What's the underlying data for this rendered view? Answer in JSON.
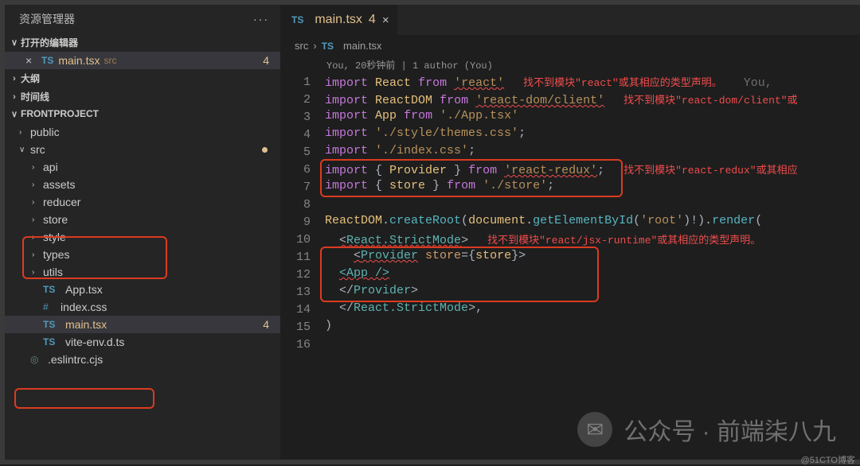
{
  "sidebar": {
    "title": "资源管理器",
    "sections": {
      "open_editors": {
        "label": "打开的编辑器"
      },
      "outline": {
        "label": "大纲"
      },
      "timeline": {
        "label": "时间线"
      },
      "project": {
        "label": "FRONTPROJECT"
      }
    },
    "open_editor": {
      "ts": "TS",
      "name": "main.tsx",
      "path": "src",
      "errors": "4"
    },
    "tree": {
      "public": "public",
      "src": "src",
      "api": "api",
      "assets": "assets",
      "reducer": "reducer",
      "store": "store",
      "style": "style",
      "types": "types",
      "utils": "utils",
      "app_tsx": "App.tsx",
      "index_css": "index.css",
      "main_tsx": "main.tsx",
      "main_tsx_err": "4",
      "vite_env": "vite-env.d.ts",
      "eslintrc": ".eslintrc.cjs"
    },
    "icons": {
      "ts": "TS",
      "hash": "#",
      "circle": "◎"
    }
  },
  "editor": {
    "tab": {
      "ts": "TS",
      "name": "main.tsx",
      "errors": "4"
    },
    "breadcrumb": {
      "src": "src",
      "sep": "›",
      "ts": "TS",
      "file": "main.tsx"
    },
    "lens": "You, 20秒钟前 | 1 author (You)",
    "line_numbers": [
      "1",
      "2",
      "3",
      "4",
      "5",
      "6",
      "7",
      "8",
      "9",
      "10",
      "11",
      "12",
      "13",
      "14",
      "15",
      "16"
    ],
    "code": {
      "l1_kw": "import",
      "l1_var": "React",
      "l1_from": "from",
      "l1_str": "'react'",
      "l1_err": "找不到模块\"react\"或其相应的类型声明。",
      "l1_dim": "You,",
      "l2_var": "ReactDOM",
      "l2_str": "'react-dom/client'",
      "l2_err": "找不到模块\"react-dom/client\"或",
      "l3_var": "App",
      "l3_str": "'./App.tsx'",
      "l4_str": "'./style/themes.css'",
      "l4_end": ";",
      "l5_str": "'./index.css'",
      "l6_open": "{ ",
      "l6_var": "Provider",
      "l6_close": " }",
      "l6_str": "'react-redux'",
      "l6_err": "找不到模块\"react-redux\"或其相应",
      "l7_var": "store",
      "l7_str": "'./store'",
      "l9_a": "ReactDOM",
      "l9_b": ".",
      "l9_c": "createRoot",
      "l9_d": "(",
      "l9_e": "document",
      "l9_f": ".",
      "l9_g": "getElementById",
      "l9_h": "(",
      "l9_i": "'root'",
      "l9_j": ")!).",
      "l9_k": "render",
      "l9_l": "(",
      "l10_open": "<",
      "l10_tag": "React.StrictMode",
      "l10_close": ">",
      "l10_err": "找不到模块\"react/jsx-runtime\"或其相应的类型声明。",
      "l11_open": "<",
      "l11_tag": "Provider",
      "l11_attr": " store",
      "l11_eq": "=",
      "l11_brace": "{",
      "l11_val": "store",
      "l11_brace2": "}",
      "l11_close": ">",
      "l12": "<App />",
      "l13_open": "</",
      "l13_tag": "Provider",
      "l13_close": ">",
      "l14_open": "</",
      "l14_tag": "React.StrictMode",
      "l14_close": ">,",
      "l15": ")"
    }
  },
  "watermark": {
    "label": "公众号 · 前端柒八九"
  },
  "credit": "@51CTO博客"
}
